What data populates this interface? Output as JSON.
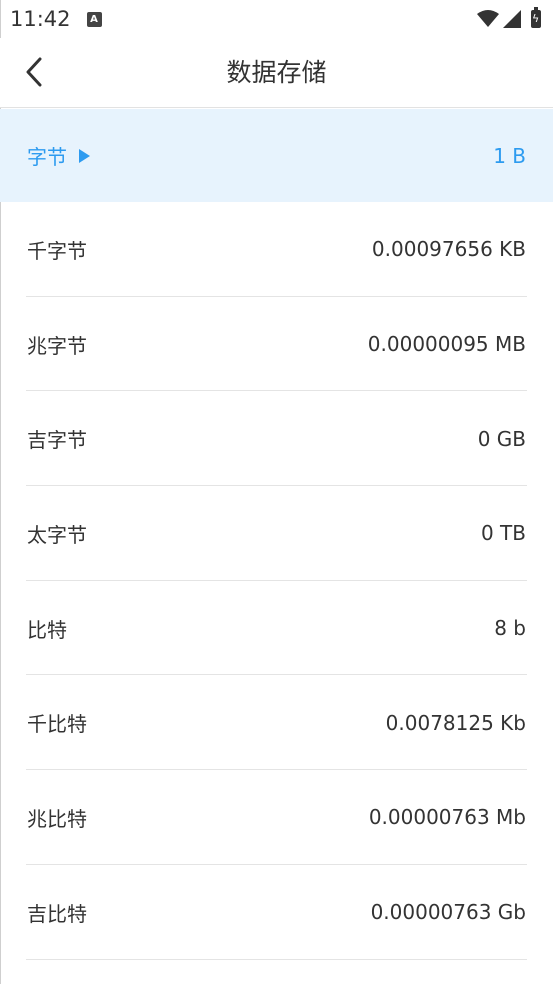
{
  "status_bar": {
    "time": "11:42",
    "notification_icon": "text-a-icon",
    "icons": [
      "wifi-icon",
      "cell-signal-icon",
      "battery-charging-icon"
    ]
  },
  "header": {
    "title": "数据存储",
    "back_icon": "chevron-left-icon"
  },
  "colors": {
    "accent": "#2d9bf0",
    "selected_bg": "#e7f3fd",
    "divider": "#e4e4e4"
  },
  "units": [
    {
      "label": "字节",
      "value": "1 B",
      "selected": true
    },
    {
      "label": "千字节",
      "value": "0.00097656 KB"
    },
    {
      "label": "兆字节",
      "value": "0.00000095 MB"
    },
    {
      "label": "吉字节",
      "value": "0 GB"
    },
    {
      "label": "太字节",
      "value": "0 TB"
    },
    {
      "label": "比特",
      "value": "8 b"
    },
    {
      "label": "千比特",
      "value": "0.0078125 Kb"
    },
    {
      "label": "兆比特",
      "value": "0.00000763 Mb"
    },
    {
      "label": "吉比特",
      "value": "0.00000763 Gb"
    }
  ]
}
